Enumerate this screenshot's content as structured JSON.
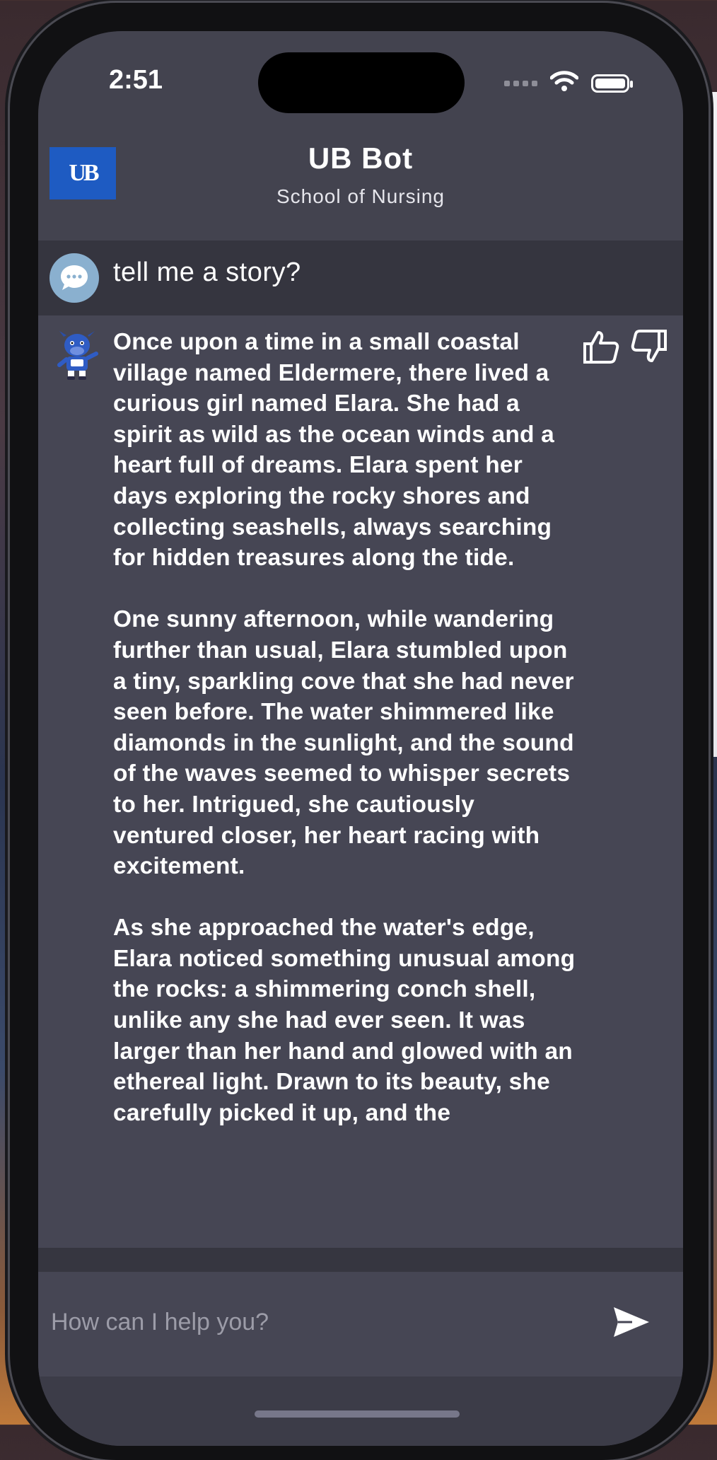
{
  "status_bar": {
    "time": "2:51"
  },
  "header": {
    "logo_text": "UB",
    "title": "UB Bot",
    "subtitle": "School of Nursing"
  },
  "chat": {
    "user_message": "tell me a story?",
    "bot_message": "Once upon a time in a small coastal village named Eldermere, there lived a curious girl named Elara. She had a spirit as wild as the ocean winds and a heart full of dreams. Elara spent her days exploring the rocky shores and collecting seashells, always searching for hidden treasures along the tide.\n\nOne sunny afternoon, while wandering further than usual, Elara stumbled upon a tiny, sparkling cove that she had never seen before. The water shimmered like diamonds in the sunlight, and the sound of the waves seemed to whisper secrets to her. Intrigued, she cautiously ventured closer, her heart racing with excitement.\n\nAs she approached the water's edge, Elara noticed something unusual among the rocks: a shimmering conch shell, unlike any she had ever seen. It was larger than her hand and glowed with an ethereal light. Drawn to its beauty, she carefully picked it up, and the"
  },
  "composer": {
    "placeholder": "How can I help you?"
  },
  "icons": {
    "user_avatar": "chat-bubble-icon",
    "bot_avatar": "bull-mascot-icon",
    "like": "thumbs-up-icon",
    "dislike": "thumbs-down-icon",
    "send": "send-icon",
    "wifi": "wifi-icon",
    "battery": "battery-icon"
  },
  "colors": {
    "logo_blue": "#1e5bc2",
    "background": "#43434f",
    "user_row": "#35353f",
    "avatar_blue": "#8ab0cf"
  }
}
